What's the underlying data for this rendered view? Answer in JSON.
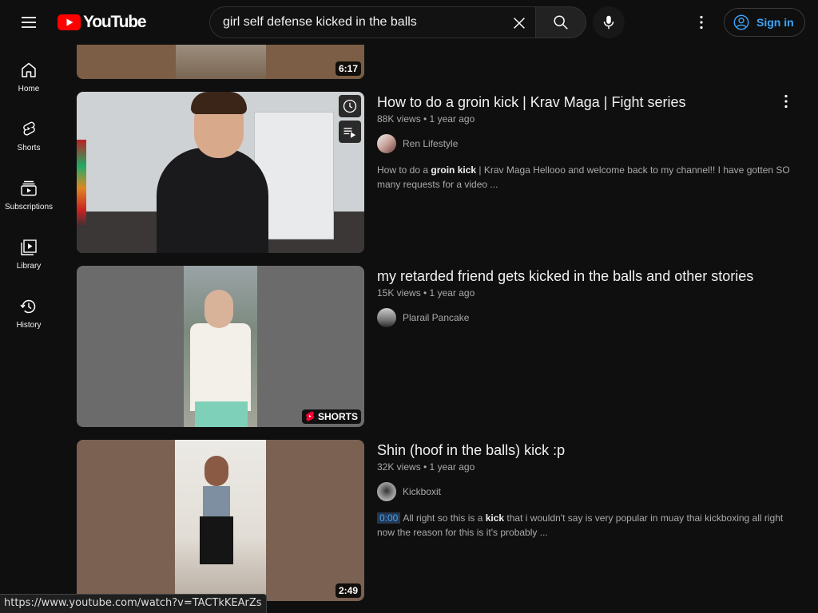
{
  "header": {
    "logo_text": "YouTube",
    "search_value": "girl self defense kicked in the balls",
    "signin_label": "Sign in"
  },
  "sidebar": {
    "items": [
      {
        "label": "Home",
        "icon": "home-icon"
      },
      {
        "label": "Shorts",
        "icon": "shorts-icon"
      },
      {
        "label": "Subscriptions",
        "icon": "subscriptions-icon"
      },
      {
        "label": "Library",
        "icon": "library-icon"
      },
      {
        "label": "History",
        "icon": "history-icon"
      }
    ]
  },
  "results": [
    {
      "duration": "6:17",
      "partial": true
    },
    {
      "title": "How to do a groin kick | Krav Maga | Fight series",
      "meta": "88K views • 1 year ago",
      "channel": "Ren Lifestyle",
      "desc_pre": "How to do a ",
      "desc_bold": "groin kick",
      "desc_post": " | Krav Maga Hellooo and welcome back to my channel!! I have gotten SO many requests for a video ..."
    },
    {
      "title": "my retarded friend gets kicked in the balls and other stories",
      "meta": "15K views • 1 year ago",
      "channel": "Plarail Pancake",
      "badge": "SHORTS"
    },
    {
      "title": "Shin (hoof in the balls) kick :p",
      "meta": "32K views • 1 year ago",
      "channel": "Kickboxit",
      "timestamp": "0:00",
      "desc_pre": "All right so this is a ",
      "desc_bold": "kick",
      "desc_post": " that i wouldn't say is very popular in muay thai kickboxing all right now the reason for this is it's probably ...",
      "duration": "2:49"
    }
  ],
  "status_url": "https://www.youtube.com/watch?v=TACTkKEArZs",
  "colors": {
    "background": "#0f0f0f",
    "accent_red": "#ff0000",
    "link_blue": "#3ea6ff"
  }
}
